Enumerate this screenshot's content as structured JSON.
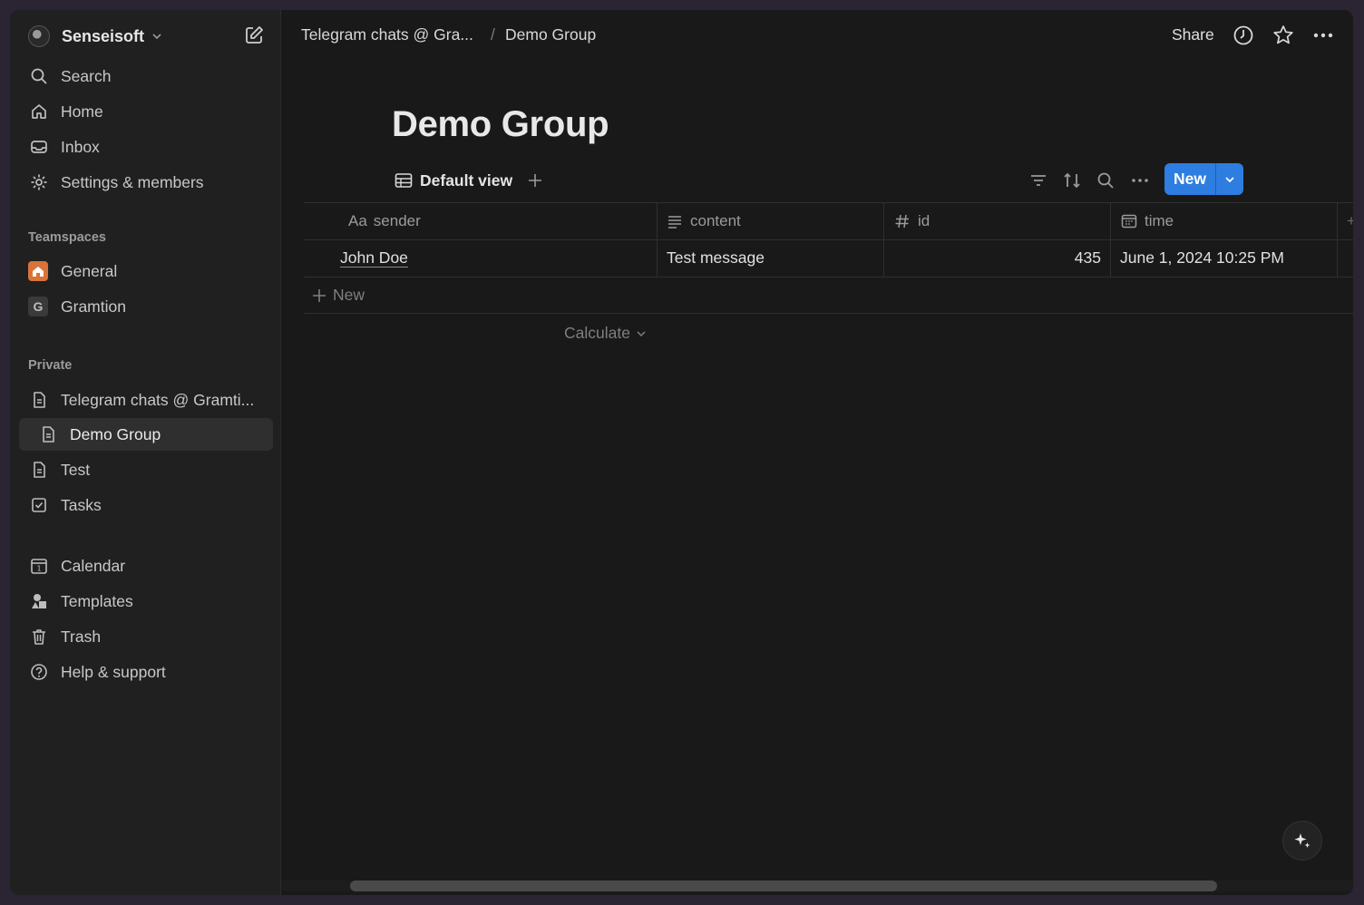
{
  "workspace": {
    "name": "Senseisoft"
  },
  "sidebar": {
    "nav": [
      {
        "label": "Search",
        "icon": "search-icon"
      },
      {
        "label": "Home",
        "icon": "home-icon"
      },
      {
        "label": "Inbox",
        "icon": "inbox-icon"
      },
      {
        "label": "Settings & members",
        "icon": "gear-icon"
      }
    ],
    "teamspaces_label": "Teamspaces",
    "teamspaces": [
      {
        "label": "General",
        "badge": "🏠",
        "icon": "home-badge-icon"
      },
      {
        "label": "Gramtion",
        "badge": "G",
        "icon": "letter-badge-icon"
      }
    ],
    "private_label": "Private",
    "private": [
      {
        "label": "Telegram chats @ Gramti...",
        "icon": "page-icon"
      },
      {
        "label": "Demo Group",
        "icon": "page-icon",
        "active": true
      },
      {
        "label": "Test",
        "icon": "page-icon"
      },
      {
        "label": "Tasks",
        "icon": "checkbox-icon"
      }
    ],
    "bottom": [
      {
        "label": "Calendar",
        "icon": "calendar-icon"
      },
      {
        "label": "Templates",
        "icon": "templates-icon"
      },
      {
        "label": "Trash",
        "icon": "trash-icon"
      },
      {
        "label": "Help & support",
        "icon": "help-icon"
      }
    ]
  },
  "topbar": {
    "breadcrumb_parent": "Telegram chats @ Gra...",
    "breadcrumb_sep": "/",
    "breadcrumb_current": "Demo Group",
    "share_label": "Share"
  },
  "page": {
    "title": "Demo Group",
    "view_label": "Default view",
    "new_label": "New"
  },
  "table": {
    "columns": [
      {
        "label": "sender",
        "prefix": "Aa",
        "icon": "title-icon"
      },
      {
        "label": "content",
        "icon": "text-icon"
      },
      {
        "label": "id",
        "icon": "number-icon"
      },
      {
        "label": "time",
        "icon": "date-icon"
      }
    ],
    "rows": [
      {
        "sender": "John Doe",
        "content": "Test message",
        "id": "435",
        "time": "June 1, 2024 10:25 PM"
      }
    ],
    "add_row_label": "New",
    "calculate_label": "Calculate"
  },
  "colors": {
    "accent": "#2e7de0",
    "background": "#191919",
    "sidebar": "#202020"
  }
}
